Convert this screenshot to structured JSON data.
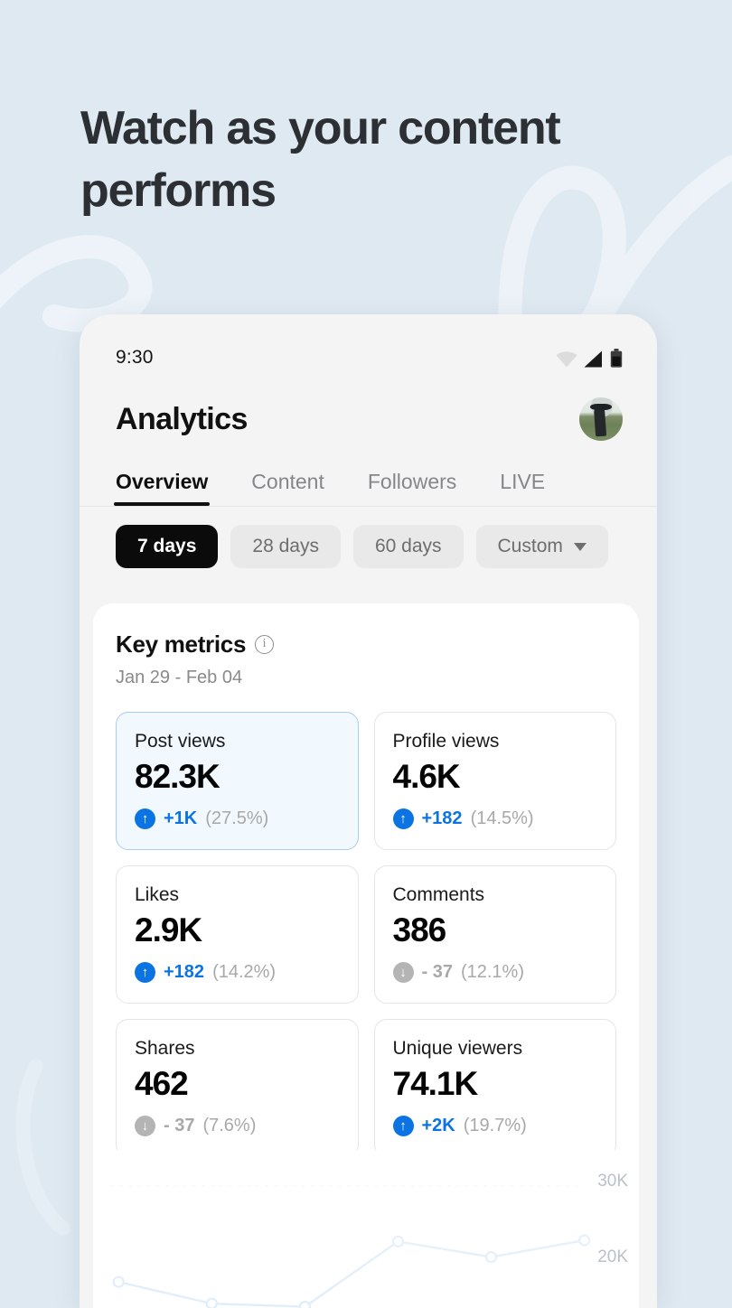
{
  "page": {
    "headline": "Watch as your content performs",
    "background_color": "#dfe9f1",
    "accent_color": "#0b74e2"
  },
  "phone": {
    "status_bar": {
      "time": "9:30",
      "icons": [
        "wifi-icon",
        "cellular-signal-icon",
        "battery-icon"
      ]
    },
    "app": {
      "title": "Analytics",
      "avatar": "profile-avatar"
    },
    "tabs": [
      {
        "label": "Overview",
        "active": true
      },
      {
        "label": "Content",
        "active": false
      },
      {
        "label": "Followers",
        "active": false
      },
      {
        "label": "LIVE",
        "active": false
      }
    ],
    "filters": [
      {
        "label": "7 days",
        "active": true,
        "dropdown": false
      },
      {
        "label": "28 days",
        "active": false,
        "dropdown": false
      },
      {
        "label": "60 days",
        "active": false,
        "dropdown": false
      },
      {
        "label": "Custom",
        "active": false,
        "dropdown": true
      }
    ],
    "key_metrics": {
      "title": "Key metrics",
      "info_icon": "info-icon",
      "date_range": "Jan 29 - Feb 04",
      "cards": [
        {
          "label": "Post views",
          "value": "82.3K",
          "direction": "up",
          "delta": "+1K",
          "percent": "(27.5%)",
          "selected": true
        },
        {
          "label": "Profile views",
          "value": "4.6K",
          "direction": "up",
          "delta": "+182",
          "percent": "(14.5%)",
          "selected": false
        },
        {
          "label": "Likes",
          "value": "2.9K",
          "direction": "up",
          "delta": "+182",
          "percent": "(14.2%)",
          "selected": false
        },
        {
          "label": "Comments",
          "value": "386",
          "direction": "down",
          "delta": "- 37",
          "percent": "(12.1%)",
          "selected": false
        },
        {
          "label": "Shares",
          "value": "462",
          "direction": "down",
          "delta": "- 37",
          "percent": "(7.6%)",
          "selected": false
        },
        {
          "label": "Unique viewers",
          "value": "74.1K",
          "direction": "up",
          "delta": "+2K",
          "percent": "(19.7%)",
          "selected": false
        }
      ]
    }
  },
  "chart_data": {
    "type": "line",
    "title": "",
    "xlabel": "",
    "ylabel": "",
    "grid": true,
    "legend_position": "none",
    "ytick_labels": [
      "30K",
      "20K"
    ],
    "yticks": [
      30000,
      20000
    ],
    "ylim": [
      10000,
      34000
    ],
    "x": [
      1,
      2,
      3,
      4,
      5,
      6
    ],
    "values": [
      14500,
      11000,
      10500,
      21000,
      18500,
      21200
    ],
    "series": [
      {
        "name": "Post views",
        "values": [
          14500,
          11000,
          10500,
          21000,
          18500,
          21200
        ]
      }
    ],
    "line_color": "#8fc0ef",
    "marker": "open-circle"
  }
}
